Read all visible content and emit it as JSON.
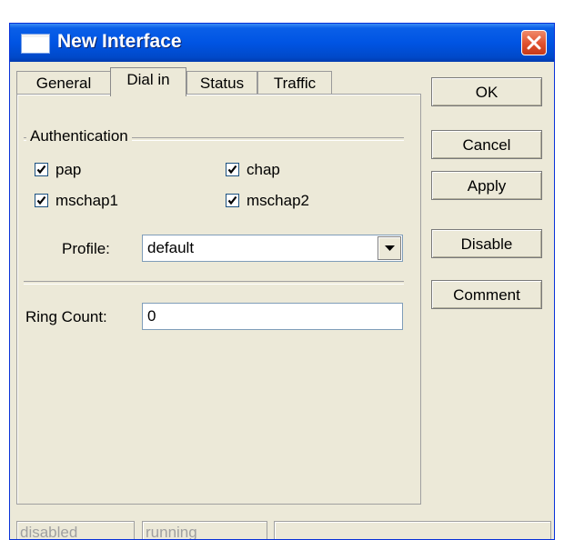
{
  "window": {
    "title": "New Interface",
    "icons": {
      "title": "window-icon",
      "close": "close-icon"
    },
    "colors": {
      "titlebar": "#0054e3",
      "close_button": "#e0502e",
      "face": "#ece9d8"
    }
  },
  "tabs": [
    {
      "label": "General",
      "active": false
    },
    {
      "label": "Dial in",
      "active": true
    },
    {
      "label": "Status",
      "active": false
    },
    {
      "label": "Traffic",
      "active": false
    }
  ],
  "dial_in": {
    "authentication": {
      "legend": "Authentication",
      "options": [
        {
          "label": "pap",
          "checked": true
        },
        {
          "label": "chap",
          "checked": true
        },
        {
          "label": "mschap1",
          "checked": true
        },
        {
          "label": "mschap2",
          "checked": true
        }
      ]
    },
    "profile": {
      "label": "Profile:",
      "value": "default",
      "icon": "chevron-down-icon"
    },
    "ring_count": {
      "label": "Ring Count:",
      "value": "0"
    }
  },
  "buttons": {
    "ok": "OK",
    "cancel": "Cancel",
    "apply": "Apply",
    "disable": "Disable",
    "comment": "Comment"
  },
  "status_bar": {
    "state": "disabled",
    "running": "running",
    "extra": ""
  }
}
